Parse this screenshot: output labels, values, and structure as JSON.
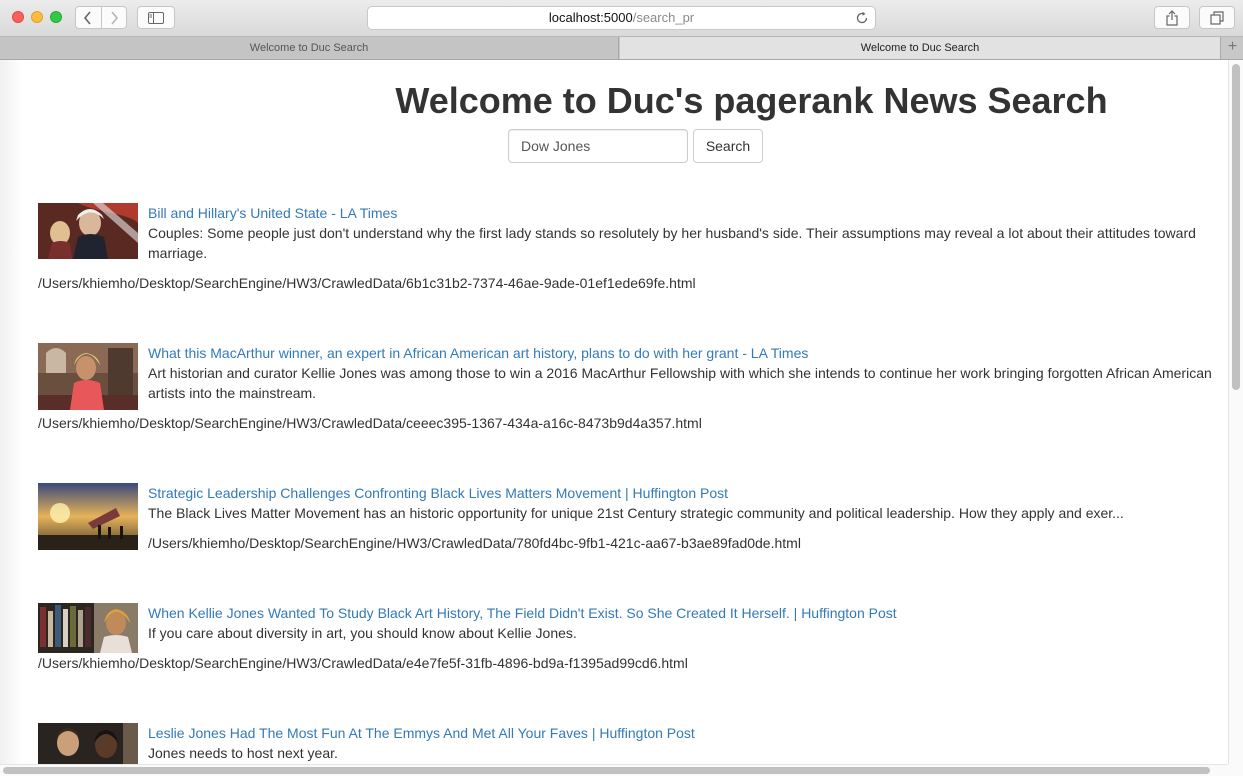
{
  "browser": {
    "url_host": "localhost:5000",
    "url_path": "/search_pr",
    "tabs": [
      {
        "label": "Welcome to Duc Search",
        "active": false
      },
      {
        "label": "Welcome to Duc Search",
        "active": true
      }
    ],
    "new_tab_label": "+"
  },
  "page": {
    "headline": "Welcome to Duc's pagerank News Search",
    "search": {
      "value": "Dow Jones",
      "button_label": "Search"
    }
  },
  "results": [
    {
      "title": "Bill and Hillary's United State - LA Times",
      "description": "Couples: Some people just don't understand why the first lady stands so resolutely by her husband's side. Their assumptions may reveal a lot about their attitudes toward marriage.",
      "path": "/Users/khiemho/Desktop/SearchEngine/HW3/CrawledData/6b1c31b2-7374-46ae-9ade-01ef1ede69fe.html",
      "thumbnail": "couple-photo"
    },
    {
      "title": "What this MacArthur winner, an expert in African American art history, plans to do with her grant - LA Times",
      "description": "Art historian and curator Kellie Jones was among those to win a 2016 MacArthur Fellowship with which she intends to continue her work bringing forgotten African American artists into the mainstream.",
      "path": "/Users/khiemho/Desktop/SearchEngine/HW3/CrawledData/ceeec395-1367-434a-a16c-8473b9d4a357.html",
      "thumbnail": "woman-portrait-photo"
    },
    {
      "title": "Strategic Leadership Challenges Confronting Black Lives Matters Movement | Huffington Post",
      "description": "The Black Lives Matter Movement has an historic opportunity for unique 21st Century strategic community and political leadership. How they apply and exer...",
      "path": "/Users/khiemho/Desktop/SearchEngine/HW3/CrawledData/780fd4bc-9fb1-421c-aa67-b3ae89fad0de.html",
      "thumbnail": "sunset-flag-photo"
    },
    {
      "title": "When Kellie Jones Wanted To Study Black Art History, The Field Didn't Exist. So She Created It Herself. | Huffington Post",
      "description": "If you care about diversity in art, you should know about Kellie Jones.",
      "path": "/Users/khiemho/Desktop/SearchEngine/HW3/CrawledData/e4e7fe5f-31fb-4896-bd9a-f1395ad99cd6.html",
      "thumbnail": "bookshelf-portrait-photo"
    },
    {
      "title": "Leslie Jones Had The Most Fun At The Emmys And Met All Your Faves | Huffington Post",
      "description": "Jones needs to host next year.",
      "path": "",
      "thumbnail": "emmys-photo"
    }
  ]
}
